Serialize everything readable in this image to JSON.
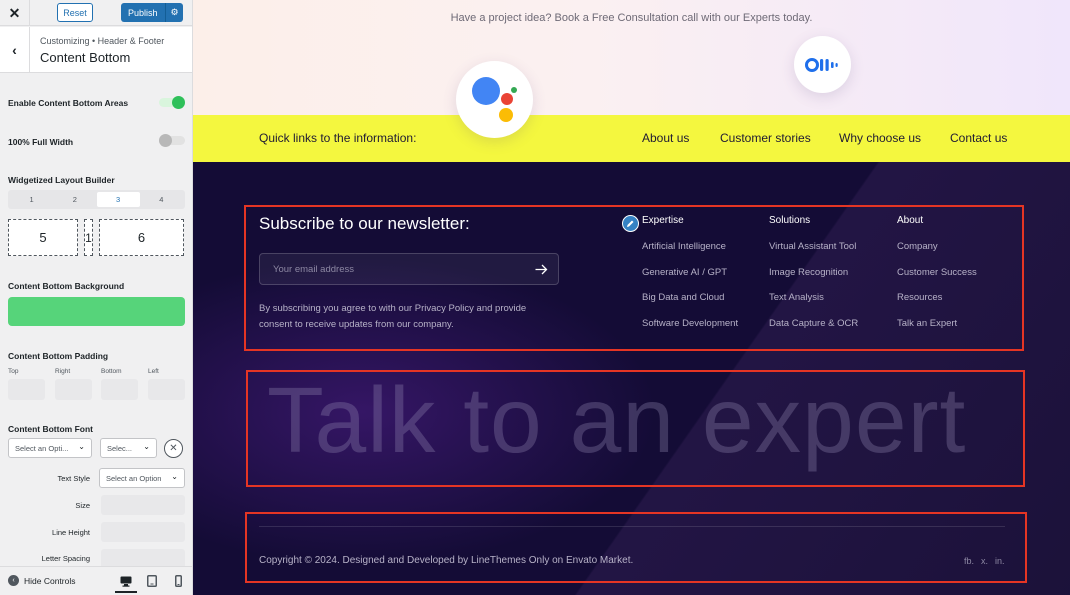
{
  "sidebar": {
    "reset_label": "Reset",
    "publish_label": "Publish",
    "breadcrumb": "Customizing • Header & Footer",
    "panel_title": "Content Bottom",
    "enable_label": "Enable Content Bottom Areas",
    "enable_on": true,
    "full_width_label": "100% Full Width",
    "full_width_on": false,
    "layout_builder_label": "Widgetized Layout Builder",
    "layout_tabs": [
      "1",
      "2",
      "3",
      "4"
    ],
    "layout_active": "3",
    "columns": [
      "5",
      "1",
      "6"
    ],
    "background_label": "Content Bottom Background",
    "background_color": "#56d47a",
    "padding_label": "Content Bottom Padding",
    "padding_fields": [
      "Top",
      "Right",
      "Bottom",
      "Left"
    ],
    "font_label": "Content Bottom Font",
    "font_family_value": "Select an Opti...",
    "font_weight_value": "Selec...",
    "text_style_label": "Text Style",
    "text_style_value": "Select an Option",
    "size_label": "Size",
    "line_height_label": "Line Height",
    "letter_spacing_label": "Letter Spacing",
    "hide_controls_label": "Hide Controls"
  },
  "preview": {
    "hero_text": "Have a project idea? Book a Free Consultation call with our Experts today.",
    "quick_label": "Quick links to the information:",
    "quick_links": [
      "About us",
      "Customer stories",
      "Why choose us",
      "Contact us"
    ],
    "accent_yellow": "#f4f73f",
    "footer_bg": "#140c36",
    "newsletter_title": "Subscribe to our newsletter:",
    "email_placeholder": "Your email address",
    "newsletter_note": "By subscribing you agree to with our Privacy Policy and provide consent to receive updates from our company.",
    "columns": [
      {
        "heading": "Expertise",
        "links": [
          "Artificial Intelligence",
          "Generative AI / GPT",
          "Big Data and Cloud",
          "Software Development"
        ]
      },
      {
        "heading": "Solutions",
        "links": [
          "Virtual Assistant Tool",
          "Image Recognition",
          "Text Analysis",
          "Data Capture & OCR"
        ]
      },
      {
        "heading": "About",
        "links": [
          "Company",
          "Customer Success",
          "Resources",
          "Talk an Expert"
        ]
      }
    ],
    "big_cta": "Talk to an expert",
    "copyright": "Copyright © 2024. Designed and Developed by LineThemes Only on Envato Market.",
    "social_links": [
      "fb.",
      "x.",
      "in."
    ]
  }
}
